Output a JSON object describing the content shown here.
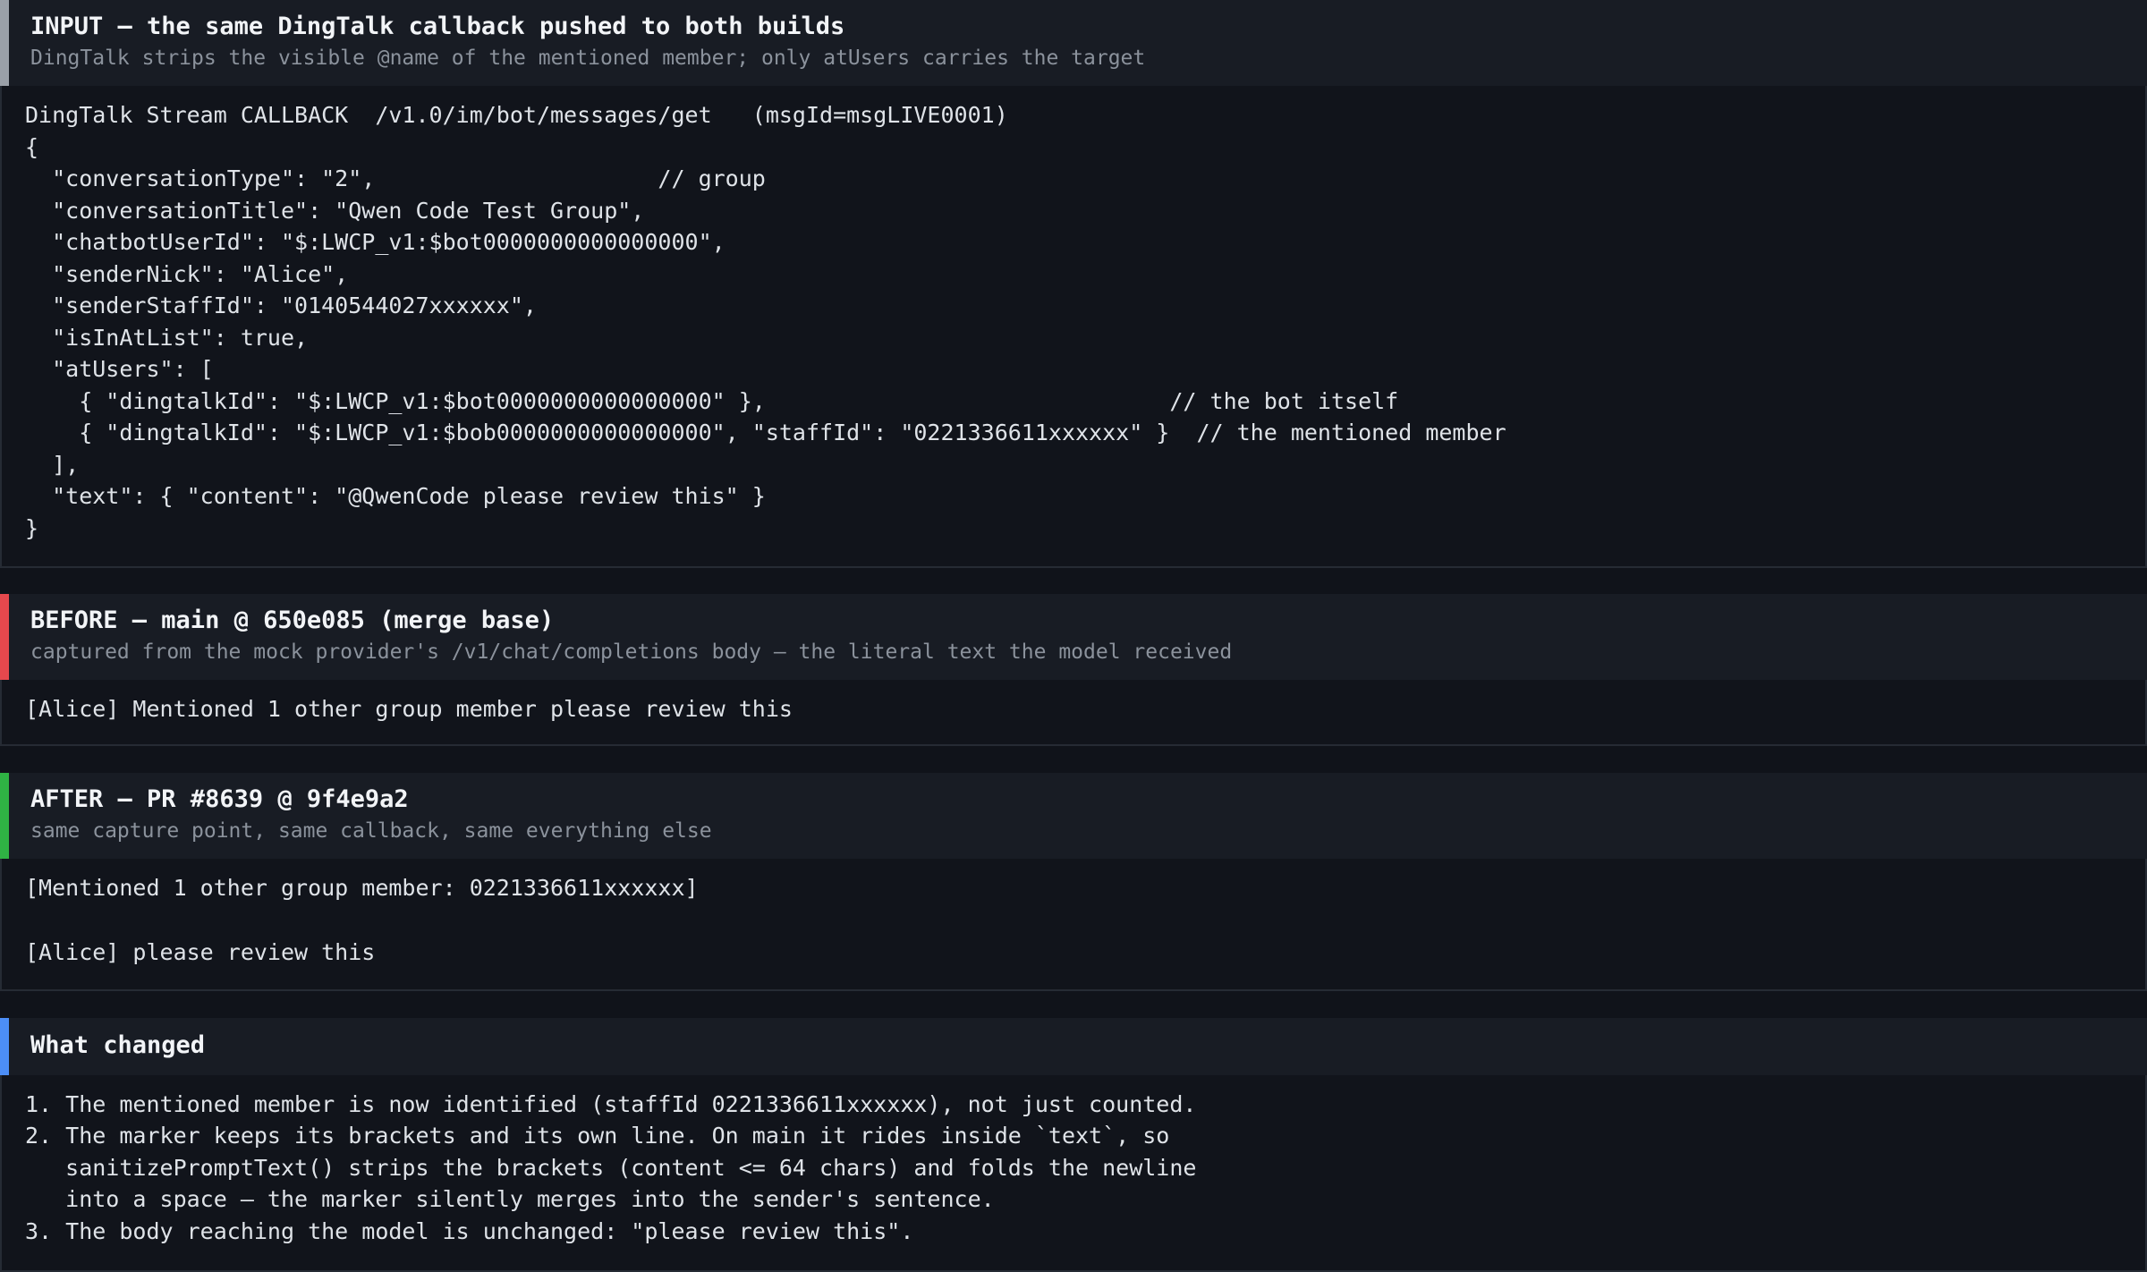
{
  "colors": {
    "input_accent": "#9aa0a8",
    "before_accent": "#e5484d",
    "after_accent": "#2fb344",
    "changed_accent": "#4c8ef7"
  },
  "input": {
    "title": "INPUT — the same DingTalk callback pushed to both builds",
    "subtitle": "DingTalk strips the visible @name of the mentioned member; only atUsers carries the target",
    "lines": [
      "DingTalk Stream CALLBACK  /v1.0/im/bot/messages/get   (msgId=msgLIVE0001)",
      "{",
      "  \"conversationType\": \"2\",                     // group",
      "  \"conversationTitle\": \"Qwen Code Test Group\",",
      "  \"chatbotUserId\": \"$:LWCP_v1:$bot0000000000000000\",",
      "  \"senderNick\": \"Alice\",",
      "  \"senderStaffId\": \"0140544027xxxxxx\",",
      "  \"isInAtList\": true,",
      "  \"atUsers\": [",
      "    { \"dingtalkId\": \"$:LWCP_v1:$bot0000000000000000\" },                              // the bot itself",
      "    { \"dingtalkId\": \"$:LWCP_v1:$bob0000000000000000\", \"staffId\": \"0221336611xxxxxx\" }  // the mentioned member",
      "  ],",
      "  \"text\": { \"content\": \"@QwenCode please review this\" }",
      "}"
    ]
  },
  "before": {
    "title": "BEFORE — main @ 650e085 (merge base)",
    "subtitle": "captured from the mock provider's /v1/chat/completions body — the literal text the model received",
    "lines": [
      "[Alice] Mentioned 1 other group member please review this"
    ]
  },
  "after": {
    "title": "AFTER — PR #8639 @ 9f4e9a2",
    "subtitle": "same capture point, same callback, same everything else",
    "lines": [
      "[Mentioned 1 other group member: 0221336611xxxxxx]",
      "",
      "[Alice] please review this"
    ]
  },
  "changed": {
    "title": "What changed",
    "lines": [
      "1. The mentioned member is now identified (staffId 0221336611xxxxxx), not just counted.",
      "2. The marker keeps its brackets and its own line. On main it rides inside `text`, so",
      "   sanitizePromptText() strips the brackets (content <= 64 chars) and folds the newline",
      "   into a space — the marker silently merges into the sender's sentence.",
      "3. The body reaching the model is unchanged: \"please review this\"."
    ]
  }
}
